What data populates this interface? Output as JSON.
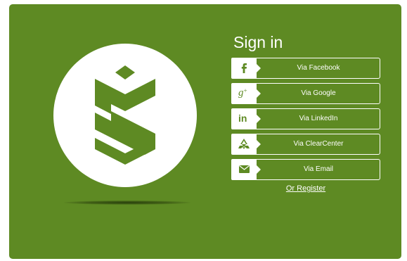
{
  "title": "Sign in",
  "colors": {
    "panel": "#5e8a23",
    "icon": "#5e8a23",
    "text": "#ffffff"
  },
  "logo": {
    "icon": "s-shield-logo-icon"
  },
  "buttons": [
    {
      "label": "Via Facebook",
      "icon": "facebook-icon"
    },
    {
      "label": "Via Google",
      "icon": "google-plus-icon"
    },
    {
      "label": "Via LinkedIn",
      "icon": "linkedin-icon"
    },
    {
      "label": "Via ClearCenter",
      "icon": "clearcenter-icon"
    },
    {
      "label": "Via Email",
      "icon": "envelope-icon"
    }
  ],
  "register_label": "Or Register"
}
